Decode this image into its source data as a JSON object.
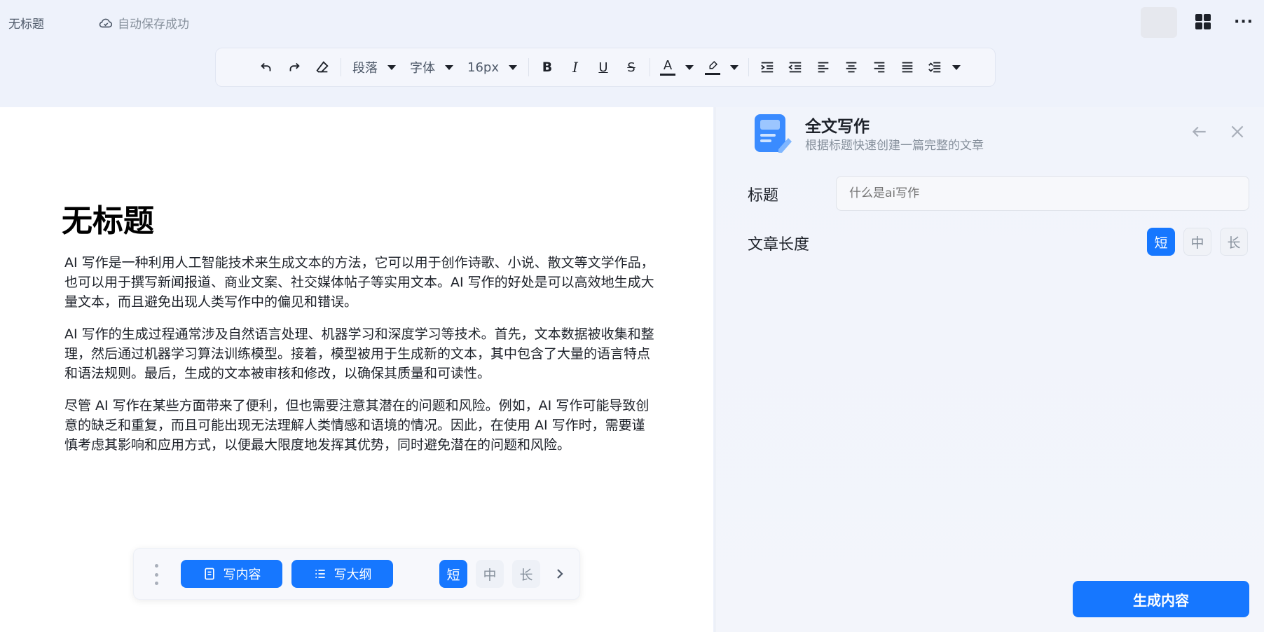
{
  "topbar": {
    "doc_name": "无标题",
    "save_status": "自动保存成功"
  },
  "toolbar": {
    "paragraph": "段落",
    "font": "字体",
    "size": "16px",
    "bold": "B",
    "italic": "I",
    "underline": "U",
    "strike": "S",
    "font_color": "A",
    "accent_color": "#1677ff"
  },
  "document": {
    "title": "无标题",
    "paragraphs": [
      "AI 写作是一种利用人工智能技术来生成文本的方法，它可以用于创作诗歌、小说、散文等文学作品，也可以用于撰写新闻报道、商业文案、社交媒体帖子等实用文本。AI 写作的好处是可以高效地生成大量文本，而且避免出现人类写作中的偏见和错误。",
      "AI 写作的生成过程通常涉及自然语言处理、机器学习和深度学习等技术。首先，文本数据被收集和整理，然后通过机器学习算法训练模型。接着，模型被用于生成新的文本，其中包含了大量的语言特点和语法规则。最后，生成的文本被审核和修改，以确保其质量和可读性。",
      "尽管 AI 写作在某些方面带来了便利，但也需要注意其潜在的问题和风险。例如，AI 写作可能导致创意的缺乏和重复，而且可能出现无法理解人类情感和语境的情况。因此，在使用 AI 写作时，需要谨慎考虑其影响和应用方式，以便最大限度地发挥其优势，同时避免潜在的问题和风险。"
    ]
  },
  "floatbar": {
    "write_content": "写内容",
    "write_outline": "写大纲",
    "lengths": [
      "短",
      "中",
      "长"
    ]
  },
  "panel": {
    "title": "全文写作",
    "subtitle": "根据标题快速创建一篇完整的文章",
    "title_label": "标题",
    "title_placeholder": "什么是ai写作",
    "length_label": "文章长度",
    "lengths": [
      "短",
      "中",
      "长"
    ],
    "generate": "生成内容"
  }
}
